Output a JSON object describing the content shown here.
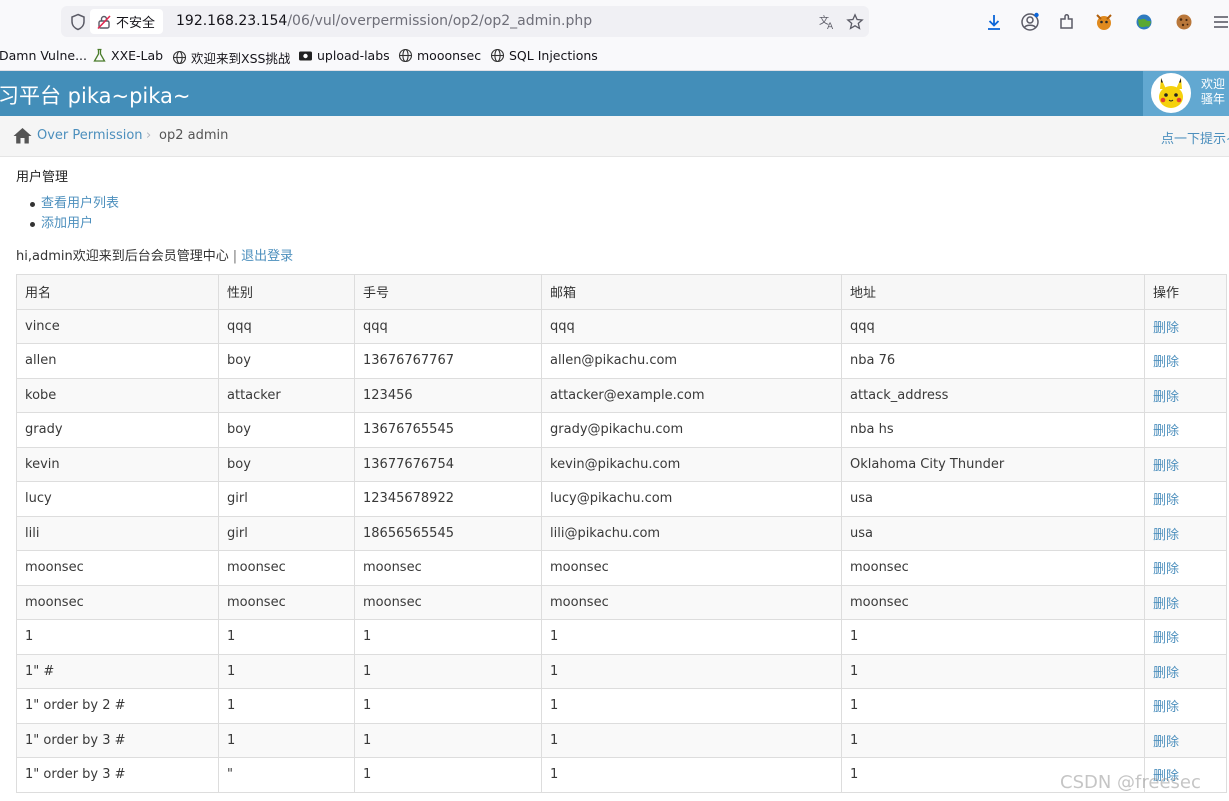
{
  "browser": {
    "insecure_label": "不安全",
    "url_host": "192.168.23.154",
    "url_path": "/06/vul/overpermission/op2/op2_admin.php",
    "bookmarks": [
      "Damn Vulne...",
      "XXE-Lab",
      "欢迎来到XSS挑战",
      "upload-labs",
      "mooonsec",
      "SQL Injections"
    ]
  },
  "header": {
    "title": "习平台 pika~pika~",
    "welcome_line1": "欢迎",
    "welcome_line2": "骚年"
  },
  "breadcrumb": {
    "parent": "Over Permission",
    "current": "op2 admin",
    "hint": "点一下提示~"
  },
  "content": {
    "section_title": "用户管理",
    "menu": [
      "查看用户列表",
      "添加用户"
    ],
    "welcome_text": "hi,admin欢迎来到后台会员管理中心",
    "separator": "|",
    "logout": "退出登录"
  },
  "table": {
    "headers": [
      "用名",
      "性别",
      "手号",
      "邮箱",
      "地址",
      "操作"
    ],
    "delete_label": "删除",
    "rows": [
      [
        "vince",
        "qqq",
        "qqq",
        "qqq",
        "qqq"
      ],
      [
        "allen",
        "boy",
        "13676767767",
        "allen@pikachu.com",
        "nba 76"
      ],
      [
        "kobe",
        "attacker",
        "123456",
        "attacker@example.com",
        "attack_address"
      ],
      [
        "grady",
        "boy",
        "13676765545",
        "grady@pikachu.com",
        "nba hs"
      ],
      [
        "kevin",
        "boy",
        "13677676754",
        "kevin@pikachu.com",
        "Oklahoma City Thunder"
      ],
      [
        "lucy",
        "girl",
        "12345678922",
        "lucy@pikachu.com",
        "usa"
      ],
      [
        "lili",
        "girl",
        "18656565545",
        "lili@pikachu.com",
        "usa"
      ],
      [
        "moonsec",
        "moonsec",
        "moonsec",
        "moonsec",
        "moonsec"
      ],
      [
        "moonsec",
        "moonsec",
        "moonsec",
        "moonsec",
        "moonsec"
      ],
      [
        "1",
        "1",
        "1",
        "1",
        "1"
      ],
      [
        "1\" #",
        "1",
        "1",
        "1",
        "1"
      ],
      [
        "1\" order by 2 #",
        "1",
        "1",
        "1",
        "1"
      ],
      [
        "1\" order by 3 #",
        "1",
        "1",
        "1",
        "1"
      ],
      [
        "1\" order by 3 #",
        "\"",
        "1",
        "1",
        "1"
      ]
    ]
  },
  "watermark": "CSDN @freesec",
  "colors": {
    "header_blue": "#438eb9",
    "link_blue": "#4c8fbd",
    "user_box_blue": "#62a8d1"
  }
}
